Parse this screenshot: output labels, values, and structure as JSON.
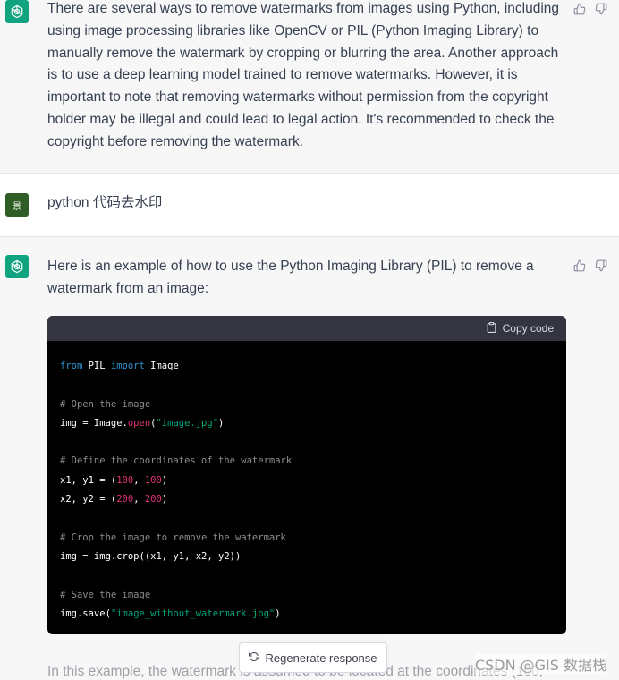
{
  "messages": [
    {
      "role": "assistant",
      "text": "There are several ways to remove watermarks from images using Python, including using image processing libraries like OpenCV or PIL (Python Imaging Library) to manually remove the watermark by cropping or blurring the area. Another approach is to use a deep learning model trained to remove watermarks. However, it is important to note that removing watermarks without permission from the copyright holder may be illegal and could lead to legal action. It's recommended to check the copyright before removing the watermark."
    },
    {
      "role": "user",
      "avatar_label": "景",
      "text": "python 代码去水印"
    },
    {
      "role": "assistant",
      "text": "Here is an example of how to use the Python Imaging Library (PIL) to remove a watermark from an image:",
      "code": {
        "copy_label": "Copy code",
        "lines": {
          "l1_kw1": "from",
          "l1_mod": " PIL ",
          "l1_kw2": "import",
          "l1_rest": " Image",
          "c1": "# Open the image",
          "l4_a": "img = Image.",
          "l4_fn": "open",
          "l4_b": "(",
          "l4_str": "\"image.jpg\"",
          "l4_c": ")",
          "c2": "# Define the coordinates of the watermark",
          "l7_a": "x1, y1 = (",
          "l7_n1": "100",
          "l7_b": ", ",
          "l7_n2": "100",
          "l7_c": ")",
          "l8_a": "x2, y2 = (",
          "l8_n1": "200",
          "l8_b": ", ",
          "l8_n2": "200",
          "l8_c": ")",
          "c3": "# Crop the image to remove the watermark",
          "l11": "img = img.crop((x1, y1, x2, y2))",
          "c4": "# Save the image",
          "l14_a": "img.save(",
          "l14_str": "\"image_without_watermark.jpg\"",
          "l14_b": ")"
        }
      }
    }
  ],
  "regenerate_label": "Regenerate response",
  "trailing_text": "In this example, the watermark is assumed to be located at the coordinates (100,",
  "watermark_text": "CSDN @GIS 数据栈",
  "colors": {
    "brand": "#10a37f",
    "assistant_bg": "#f7f7f8",
    "code_header": "#343541",
    "code_keyword": "#2e95d3",
    "code_string": "#00a67d",
    "code_number": "#df3079",
    "code_comment": "#8c8c8c"
  },
  "icons": {
    "assistant_avatar": "openai-logo-icon",
    "thumbs_up": "thumbs-up-icon",
    "thumbs_down": "thumbs-down-icon",
    "copy": "clipboard-icon",
    "regenerate": "refresh-icon"
  }
}
